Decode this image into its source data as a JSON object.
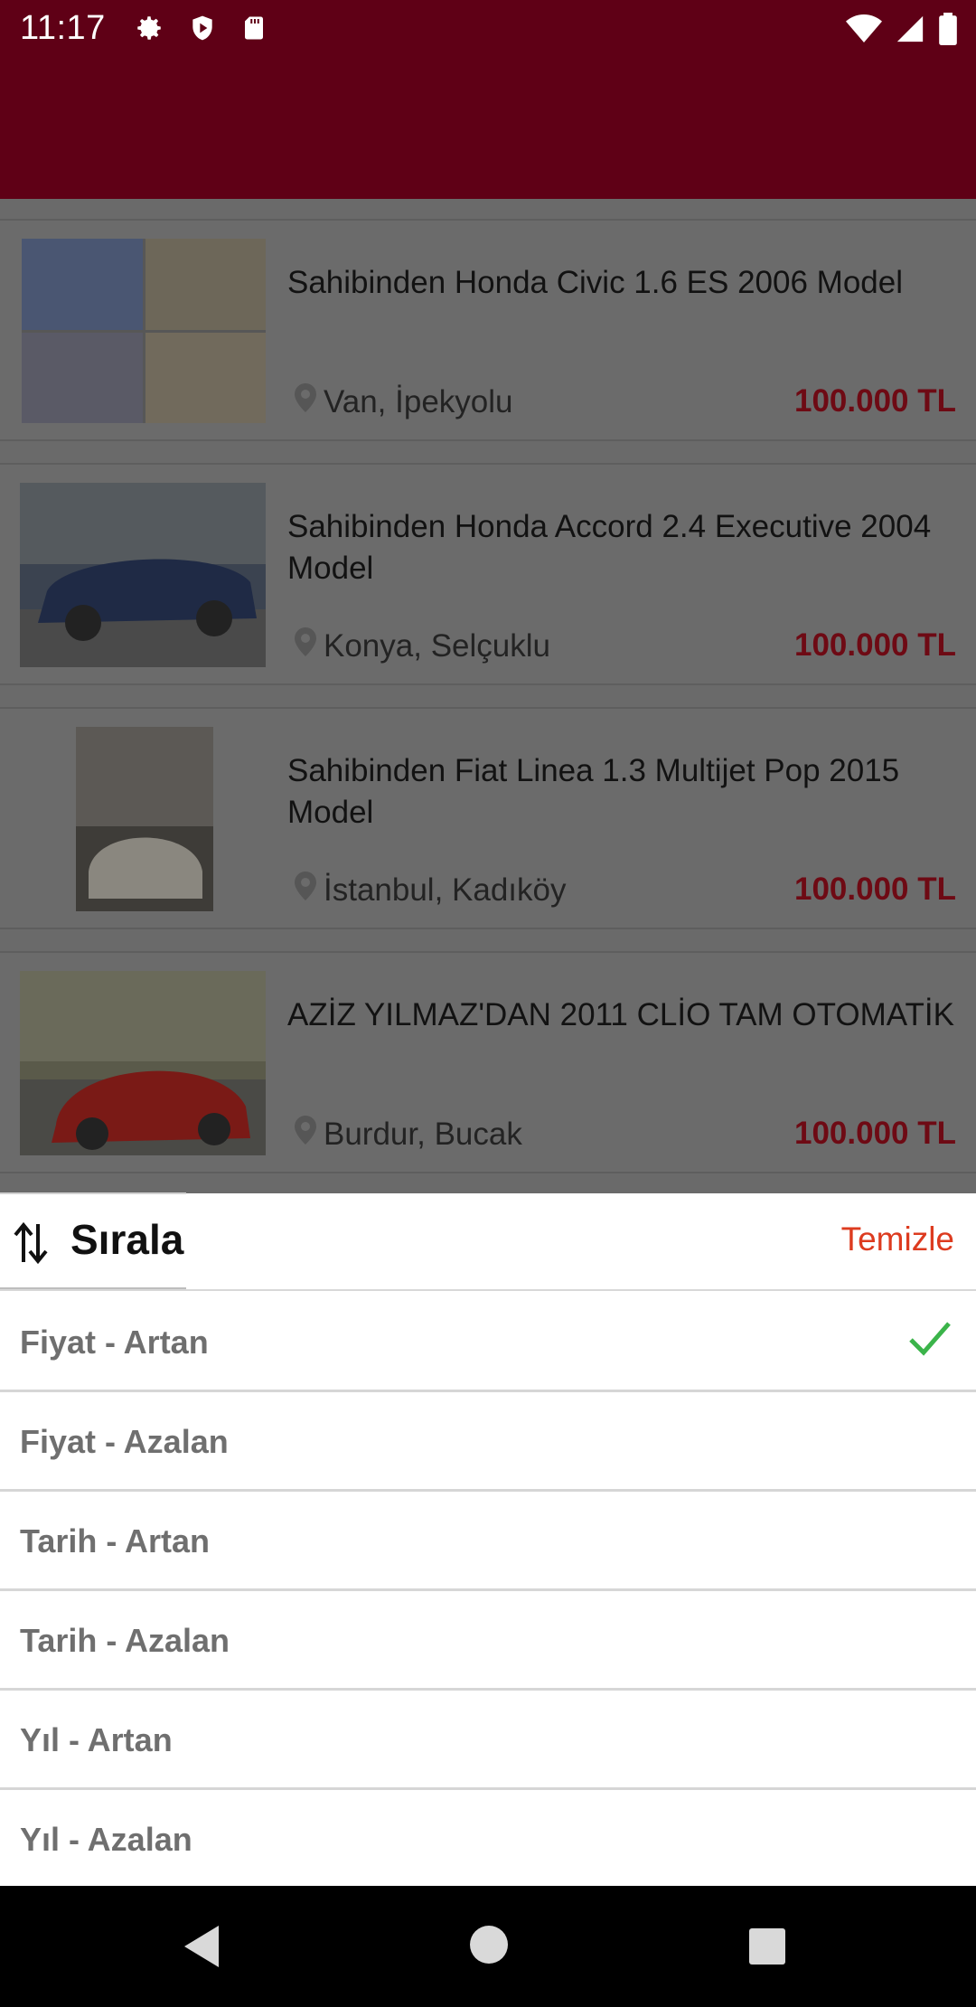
{
  "status_bar": {
    "time": "11:17",
    "left_icons": [
      "gear-icon",
      "shield-icon",
      "sd-card-icon"
    ],
    "right_icons": [
      "wifi-icon",
      "signal-icon",
      "battery-icon"
    ]
  },
  "colors": {
    "app_bar": "#5f0016",
    "price": "#c4001f",
    "clear": "#dd3b1f",
    "check": "#3bb44a"
  },
  "listings": [
    {
      "title": "Sahibinden Honda Civic 1.6 ES 2006 Model",
      "location": "Van, İpekyolu",
      "price": "100.000 TL"
    },
    {
      "title": "Sahibinden Honda Accord 2.4 Executive 2004 Model",
      "location": "Konya, Selçuklu",
      "price": "100.000 TL"
    },
    {
      "title": "Sahibinden Fiat Linea 1.3 Multijet Pop 2015 Model",
      "location": "İstanbul, Kadıköy",
      "price": "100.000 TL"
    },
    {
      "title": "AZİZ YILMAZ'DAN 2011 CLİO TAM OTOMATİK",
      "location": "Burdur, Bucak",
      "price": "100.000 TL"
    }
  ],
  "sort_sheet": {
    "title": "Sırala",
    "clear_label": "Temizle",
    "options": [
      {
        "label": "Fiyat - Artan",
        "selected": true
      },
      {
        "label": "Fiyat - Azalan",
        "selected": false
      },
      {
        "label": "Tarih - Artan",
        "selected": false
      },
      {
        "label": "Tarih - Azalan",
        "selected": false
      },
      {
        "label": "Yıl - Artan",
        "selected": false
      },
      {
        "label": "Yıl - Azalan",
        "selected": false
      }
    ]
  },
  "nav_bar": [
    "back-icon",
    "home-icon",
    "recents-icon"
  ]
}
